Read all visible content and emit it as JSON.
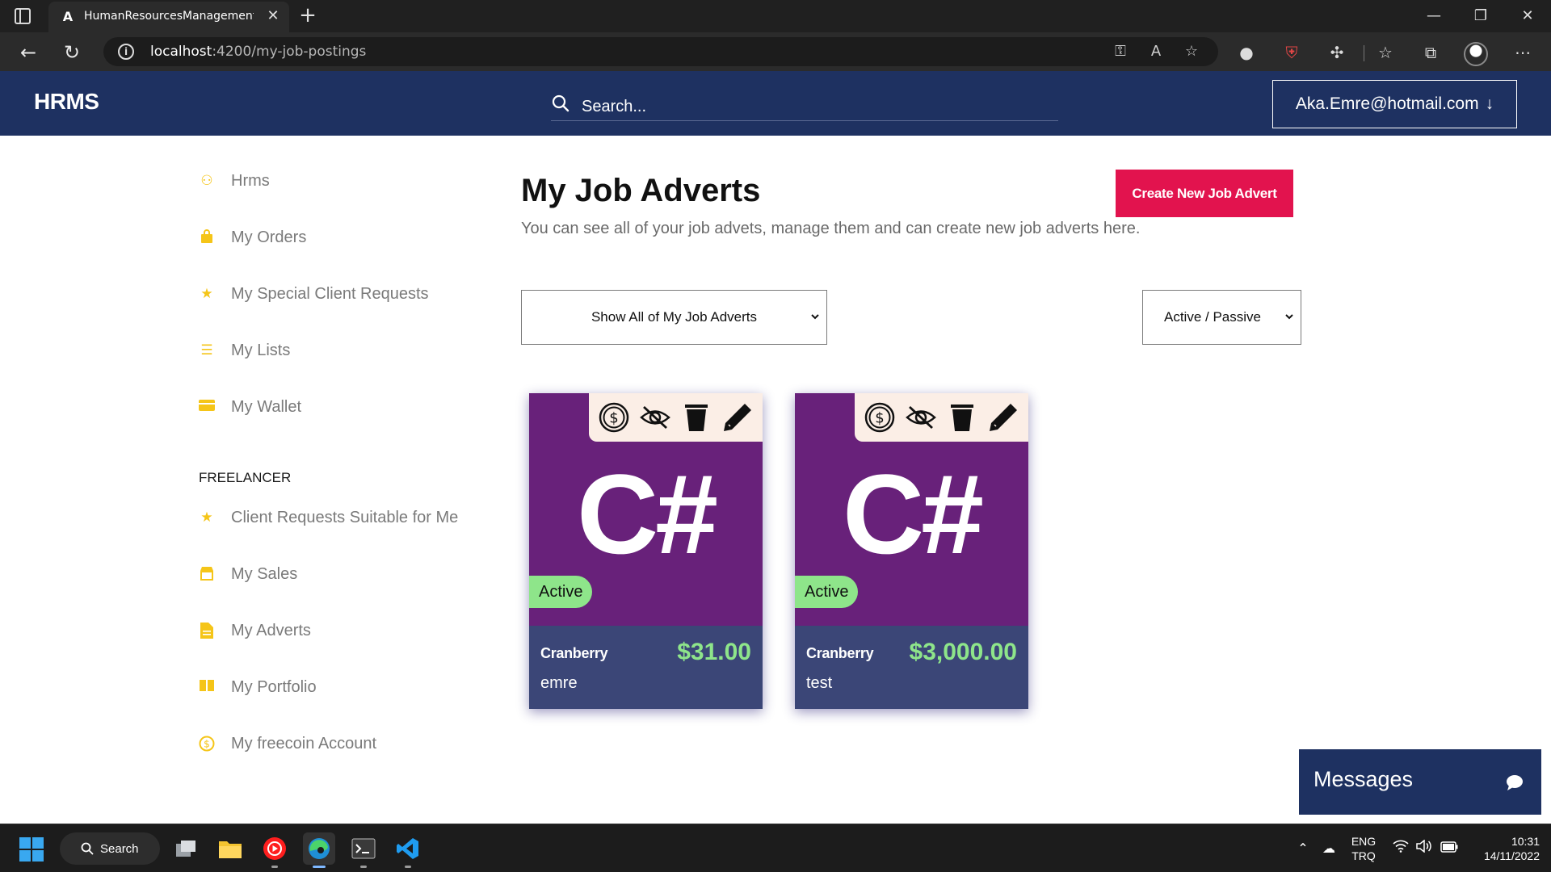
{
  "browser": {
    "tab_title": "HumanResourcesManagementSy",
    "tab_favicon": "A",
    "url_host": "localhost",
    "url_path": ":4200/my-job-postings"
  },
  "header": {
    "brand": "HRMS",
    "search_placeholder": "Search...",
    "user_email": "Aka.Emre@hotmail.com",
    "user_arrow": "↓"
  },
  "sidebar": {
    "items": [
      {
        "label": "Hrms",
        "icon": "users-icon"
      },
      {
        "label": "My Orders",
        "icon": "shopping-bag-icon"
      },
      {
        "label": "My Special Client Requests",
        "icon": "star-icon"
      },
      {
        "label": "My Lists",
        "icon": "list-icon"
      },
      {
        "label": "My Wallet",
        "icon": "wallet-icon"
      }
    ],
    "section_heading": "FREELANCER",
    "freelancer_items": [
      {
        "label": "Client Requests Suitable for Me",
        "icon": "star-icon"
      },
      {
        "label": "My Sales",
        "icon": "store-icon"
      },
      {
        "label": "My Adverts",
        "icon": "file-icon"
      },
      {
        "label": "My Portfolio",
        "icon": "book-icon"
      },
      {
        "label": "My freecoin Account",
        "icon": "coin-icon"
      }
    ]
  },
  "main": {
    "title": "My Job Adverts",
    "subtitle": "You can see all of your job advets, manage them and can create new job adverts here.",
    "create_button": "Create New Job Advert",
    "filter_select": "Show All of My Job Adverts",
    "status_select": "Active / Passive"
  },
  "cards": [
    {
      "logo": "C#",
      "status": "Active",
      "company": "Cranberry",
      "price": "$31.00",
      "user": "emre"
    },
    {
      "logo": "C#",
      "status": "Active",
      "company": "Cranberry",
      "price": "$3,000.00",
      "user": "test"
    }
  ],
  "messages": {
    "label": "Messages"
  },
  "taskbar": {
    "search_label": "Search",
    "lang_top": "ENG",
    "lang_bottom": "TRQ",
    "time": "10:31",
    "date": "14/11/2022"
  },
  "colors": {
    "header_bg": "#1e3161",
    "accent_red": "#e2134e",
    "card_purple": "#68217a",
    "card_footer": "#3b4677",
    "price_green": "#8ee58a",
    "sidebar_icon": "#f5c518"
  }
}
